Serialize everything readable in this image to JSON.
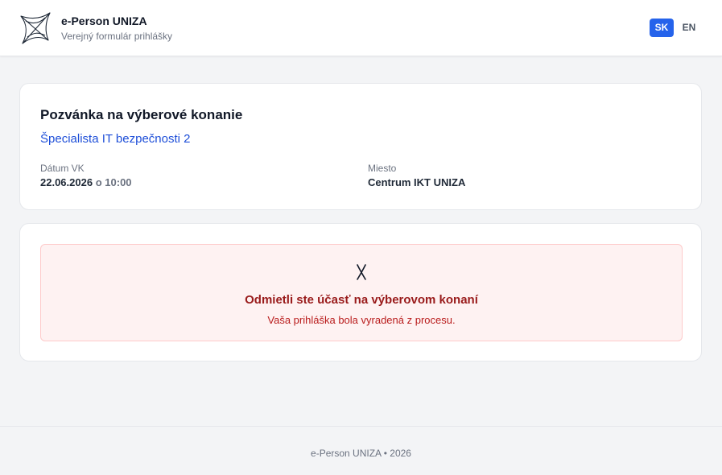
{
  "header": {
    "logo_icon": "star-outline-logo-icon",
    "title": "e-Person UNIZA",
    "subtitle": "Verejný formulár prihlášky",
    "languages": [
      {
        "code": "SK",
        "active": true
      },
      {
        "code": "EN",
        "active": false
      }
    ],
    "accent_color": "#2563eb"
  },
  "invitation": {
    "title": "Pozvánka na výberové konanie",
    "position": "Špecialista IT bezpečnosti 2",
    "date_label": "Dátum VK",
    "date_value": "22.06.2026",
    "time_prefix": "o",
    "time_value": "10:00",
    "place_label": "Miesto",
    "place_value": "Centrum IKT UNIZA"
  },
  "status": {
    "icon": "x-icon",
    "title": "Odmietli ste účasť na výberovom konaní",
    "message": "Vaša prihláška bola vyradená z procesu.",
    "bg_color": "#fef2f2",
    "border_color": "#fecaca",
    "text_color": "#991b1b"
  },
  "footer": {
    "text": "e-Person UNIZA • 2026"
  }
}
